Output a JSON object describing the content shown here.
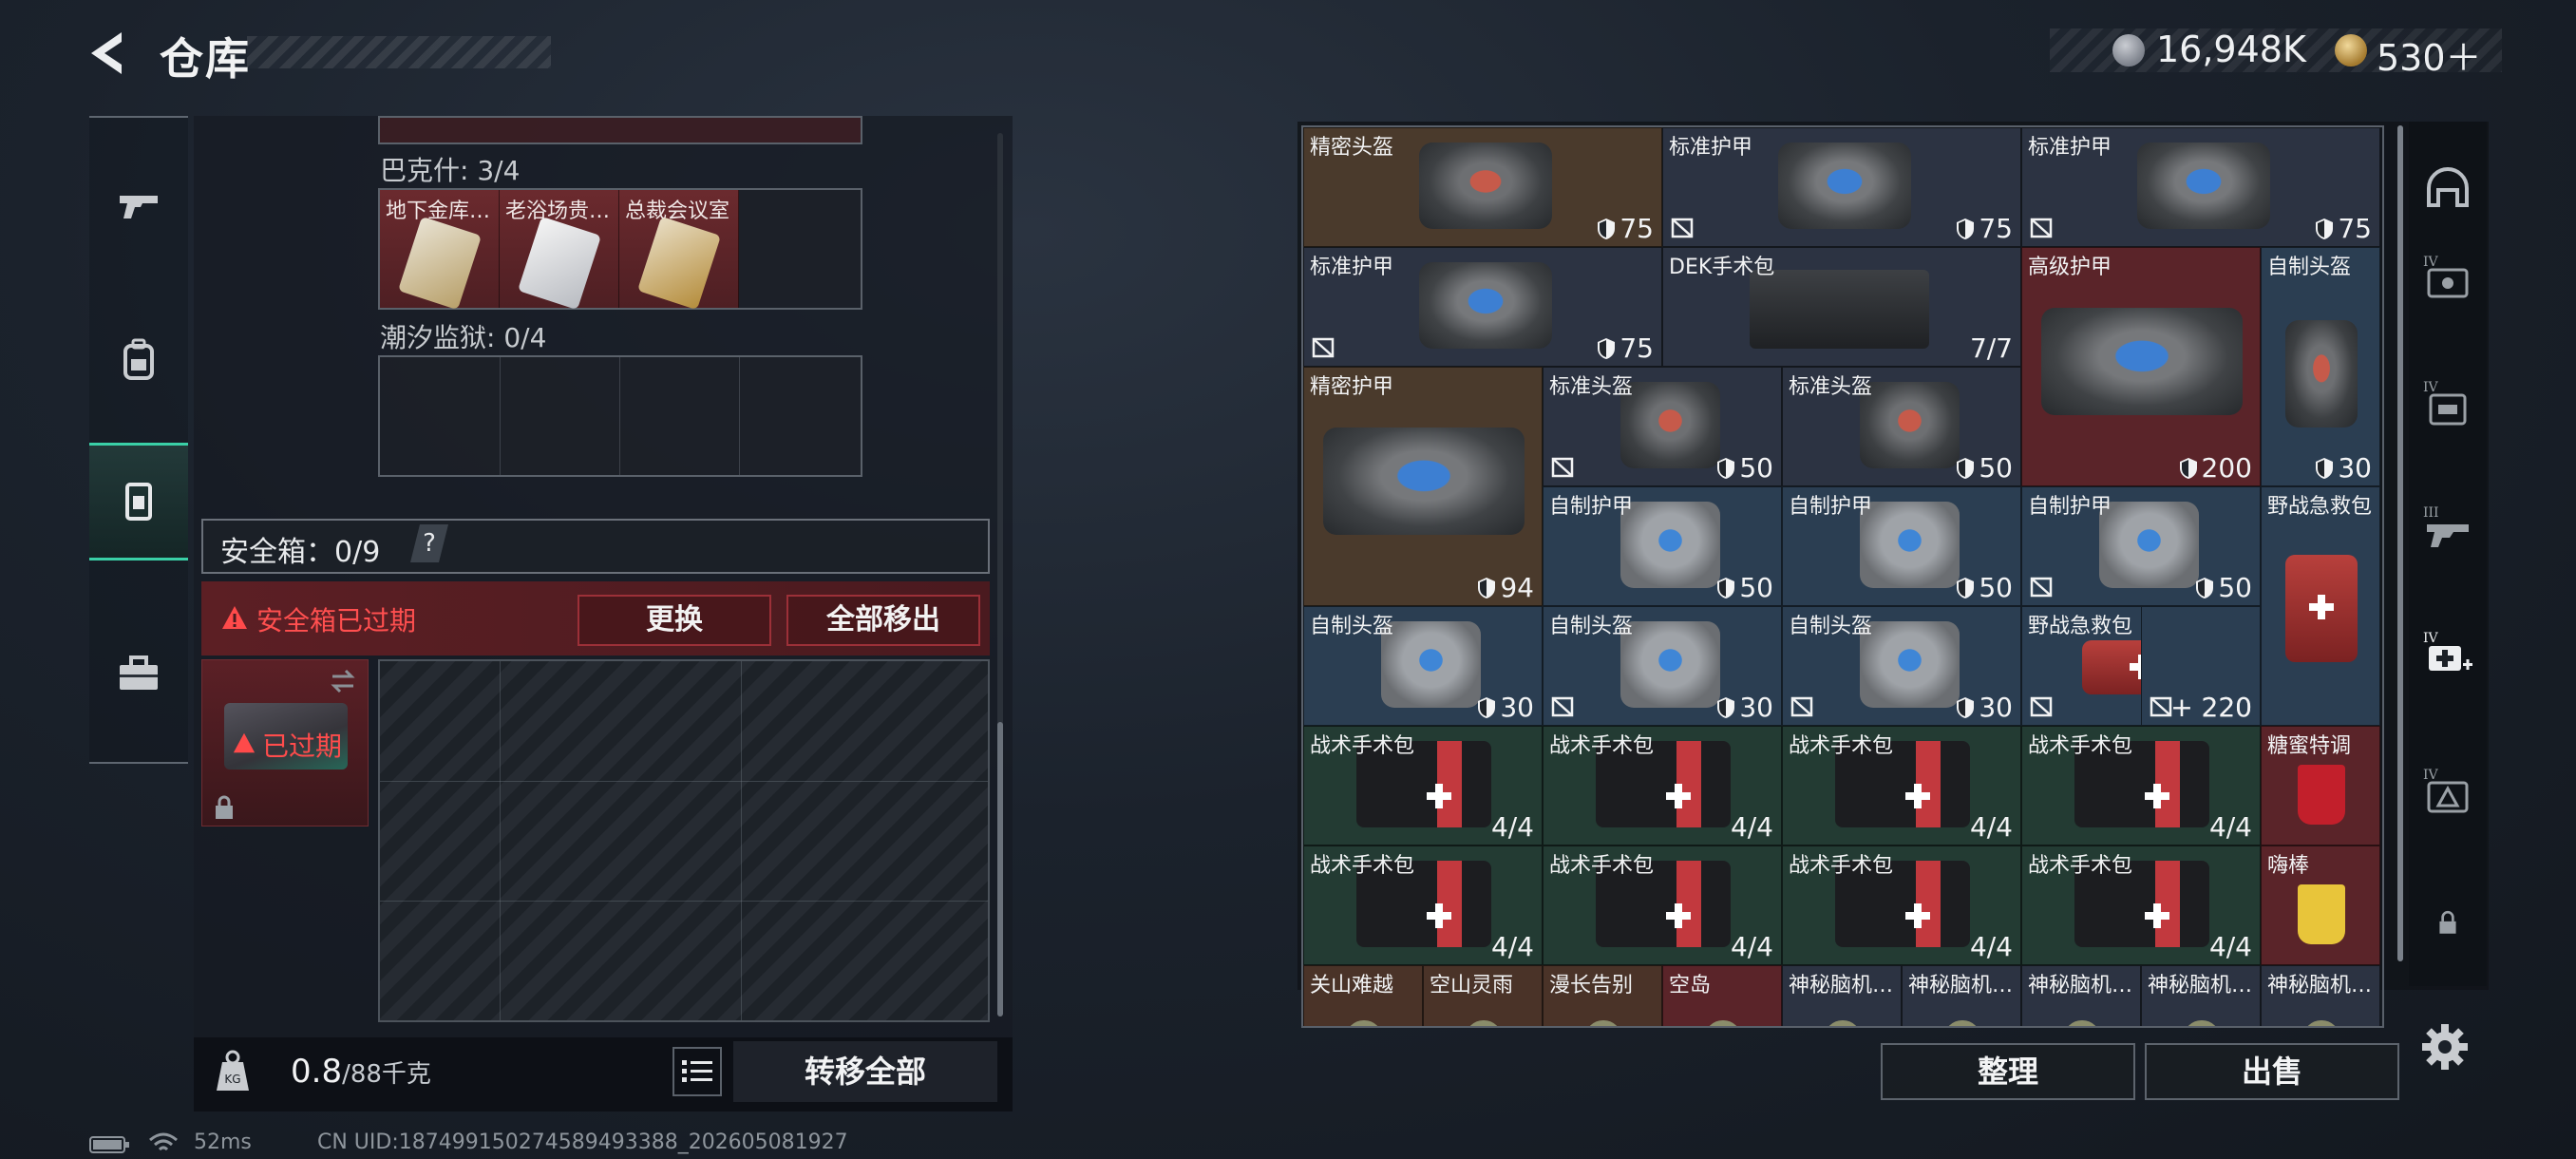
{
  "header": {
    "title": "仓库",
    "currency1": "16,948K",
    "currency2": "530＋"
  },
  "nav": {
    "items": [
      "gun-icon",
      "backpack-icon",
      "safebox-icon",
      "briefcase-icon"
    ],
    "active_index": 2
  },
  "left": {
    "bakeshi_label": "巴克什: 3/4",
    "keys": [
      "地下金库…",
      "老浴场贵…",
      "总裁会议室"
    ],
    "prison_label": "潮汐监狱: 0/4",
    "safebox_title": "安全箱：0/9",
    "safebox_help": "?",
    "expired_notice": "安全箱已过期",
    "swap_label": "更换",
    "move_all_label": "全部移出",
    "slot_expired_label": "已过期",
    "weight_current": "0.8",
    "weight_max": "/88千克",
    "transfer_all_label": "转移全部"
  },
  "status": {
    "ping": "52ms",
    "uid": "CN UID:1874991502745894933​88_202605081927"
  },
  "inventory": {
    "items": [
      {
        "label": "精密头盔",
        "value": "75",
        "kind": "helmet",
        "bg": "#4a3a2c",
        "nodur": false,
        "shield": true
      },
      {
        "label": "标准护甲",
        "value": "75",
        "kind": "vest",
        "bg": "#2c3342",
        "nodur": true,
        "shield": true
      },
      {
        "label": "标准护甲",
        "value": "75",
        "kind": "vest",
        "bg": "#2c3342",
        "nodur": true,
        "shield": true
      },
      {
        "label": "标准护甲",
        "value": "75",
        "kind": "vest",
        "bg": "#2c3342",
        "nodur": true,
        "shield": true
      },
      {
        "label": "DEK手术包",
        "value": "7/7",
        "kind": "surgery",
        "bg": "#2c3342",
        "nodur": false,
        "shield": false
      },
      {
        "label": "高级护甲",
        "value": "200",
        "kind": "vest-big",
        "bg": "#5a2429",
        "nodur": false,
        "shield": true
      },
      {
        "label": "自制头盔",
        "value": "30",
        "kind": "helmet-tall",
        "bg": "#2b3e52",
        "nodur": false,
        "shield": true
      },
      {
        "label": "精密护甲",
        "value": "94",
        "kind": "vest-tall",
        "bg": "#4a3a2c",
        "nodur": false,
        "shield": true
      },
      {
        "label": "标准头盔",
        "value": "50",
        "kind": "helmet",
        "bg": "#2c3342",
        "nodur": true,
        "shield": true
      },
      {
        "label": "标准头盔",
        "value": "50",
        "kind": "helmet",
        "bg": "#2c3342",
        "nodur": false,
        "shield": true
      },
      {
        "label": "自制护甲",
        "value": "50",
        "kind": "vest-white",
        "bg": "#2b3e52",
        "nodur": false,
        "shield": true
      },
      {
        "label": "自制护甲",
        "value": "50",
        "kind": "vest-white",
        "bg": "#2b3e52",
        "nodur": false,
        "shield": true
      },
      {
        "label": "自制护甲",
        "value": "50",
        "kind": "vest-white",
        "bg": "#2b3e52",
        "nodur": true,
        "shield": true
      },
      {
        "label": "野战急救包",
        "value": "",
        "kind": "medkit-red-tall",
        "bg": "#2b3e52",
        "nodur": false,
        "shield": false
      },
      {
        "label": "自制头盔",
        "value": "30",
        "kind": "helmet-white",
        "bg": "#2b3e52",
        "nodur": false,
        "shield": true
      },
      {
        "label": "自制头盔",
        "value": "30",
        "kind": "helmet-white",
        "bg": "#2b3e52",
        "nodur": true,
        "shield": true
      },
      {
        "label": "自制头盔",
        "value": "30",
        "kind": "helmet-white",
        "bg": "#2b3e52",
        "nodur": true,
        "shield": true
      },
      {
        "label": "野战急救包",
        "value": "+ 220",
        "kind": "medkit-red",
        "bg": "#2b3e52",
        "nodur": true,
        "shield": false
      },
      {
        "label": "",
        "value": "+ 220",
        "kind": "none",
        "bg": "#2b3e52",
        "nodur": true,
        "shield": false
      },
      {
        "label": "战术手术包",
        "value": "4/4",
        "kind": "medkit-dark",
        "bg": "#233b33",
        "nodur": false,
        "shield": false
      },
      {
        "label": "战术手术包",
        "value": "4/4",
        "kind": "medkit-dark",
        "bg": "#233b33",
        "nodur": false,
        "shield": false
      },
      {
        "label": "战术手术包",
        "value": "4/4",
        "kind": "medkit-dark",
        "bg": "#233b33",
        "nodur": false,
        "shield": false
      },
      {
        "label": "战术手术包",
        "value": "4/4",
        "kind": "medkit-dark",
        "bg": "#233b33",
        "nodur": false,
        "shield": false
      },
      {
        "label": "糖蜜特调",
        "value": "",
        "kind": "drink-red",
        "bg": "#5a2429",
        "nodur": false,
        "shield": false
      },
      {
        "label": "战术手术包",
        "value": "4/4",
        "kind": "medkit-dark",
        "bg": "#233b33",
        "nodur": false,
        "shield": false
      },
      {
        "label": "战术手术包",
        "value": "4/4",
        "kind": "medkit-dark",
        "bg": "#233b33",
        "nodur": false,
        "shield": false
      },
      {
        "label": "战术手术包",
        "value": "4/4",
        "kind": "medkit-dark",
        "bg": "#233b33",
        "nodur": false,
        "shield": false
      },
      {
        "label": "战术手术包",
        "value": "4/4",
        "kind": "medkit-dark",
        "bg": "#233b33",
        "nodur": false,
        "shield": false
      },
      {
        "label": "嗨棒",
        "value": "",
        "kind": "drink-yellow",
        "bg": "#5a2429",
        "nodur": false,
        "shield": false
      },
      {
        "label": "关山难越",
        "value": "",
        "kind": "small",
        "bg": "#4a3328",
        "nodur": false,
        "shield": false
      },
      {
        "label": "空山灵雨",
        "value": "",
        "kind": "small",
        "bg": "#4a3328",
        "nodur": false,
        "shield": false
      },
      {
        "label": "漫长告别",
        "value": "",
        "kind": "small",
        "bg": "#4a3328",
        "nodur": false,
        "shield": false
      },
      {
        "label": "空岛",
        "value": "",
        "kind": "small",
        "bg": "#5a2429",
        "nodur": false,
        "shield": false
      },
      {
        "label": "神秘脑机…",
        "value": "",
        "kind": "small",
        "bg": "#2c3342",
        "nodur": false,
        "shield": false
      },
      {
        "label": "神秘脑机…",
        "value": "",
        "kind": "small",
        "bg": "#2c3342",
        "nodur": false,
        "shield": false
      },
      {
        "label": "神秘脑机…",
        "value": "",
        "kind": "small",
        "bg": "#2c3342",
        "nodur": false,
        "shield": false
      },
      {
        "label": "神秘脑机…",
        "value": "",
        "kind": "small",
        "bg": "#2c3342",
        "nodur": false,
        "shield": false
      },
      {
        "label": "神秘脑机…",
        "value": "",
        "kind": "small",
        "bg": "#2c3342",
        "nodur": false,
        "shield": false
      }
    ]
  },
  "right_tabs": [
    "helmet-slot-icon",
    "level4-chest-rig-icon",
    "level4-backpack-icon",
    "level3-gun-icon",
    "level4-medkit-add-icon",
    "level4-device-icon",
    "lock-icon"
  ],
  "actions": {
    "sort_label": "整理",
    "sell_label": "出售"
  }
}
